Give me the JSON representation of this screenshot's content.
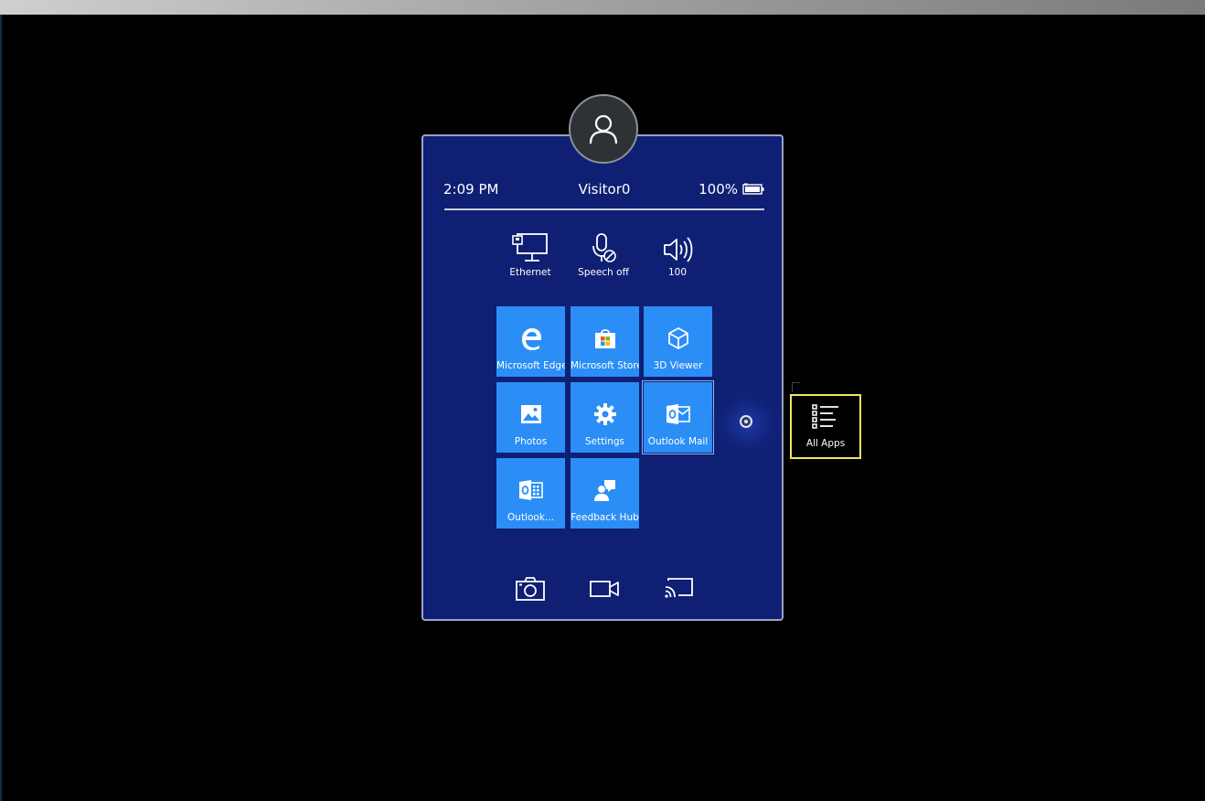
{
  "status": {
    "time": "2:09 PM",
    "user": "Visitor0",
    "battery": "100%"
  },
  "quick_settings": [
    {
      "label": "Ethernet",
      "icon": "ethernet-icon"
    },
    {
      "label": "Speech off",
      "icon": "microphone-off-icon"
    },
    {
      "label": "100",
      "icon": "volume-icon"
    }
  ],
  "tiles": [
    {
      "label": "Microsoft Edge",
      "icon": "edge-icon"
    },
    {
      "label": "Microsoft Store",
      "icon": "store-icon"
    },
    {
      "label": "3D Viewer",
      "icon": "cube-icon"
    },
    {
      "label": "Photos",
      "icon": "photos-icon"
    },
    {
      "label": "Settings",
      "icon": "gear-icon"
    },
    {
      "label": "Outlook Mail",
      "icon": "outlook-mail-icon"
    },
    {
      "label": "Outlook...",
      "icon": "outlook-calendar-icon"
    },
    {
      "label": "Feedback Hub",
      "icon": "feedback-icon"
    }
  ],
  "bottom_bar": [
    {
      "icon": "camera-icon"
    },
    {
      "icon": "video-icon"
    },
    {
      "icon": "cast-icon"
    }
  ],
  "all_apps": {
    "label": "All Apps",
    "icon": "list-icon"
  },
  "colors": {
    "panel_bg": "#0f1f73",
    "tile_bg": "#2b8ef6",
    "focus_border": "#f2e65a"
  }
}
